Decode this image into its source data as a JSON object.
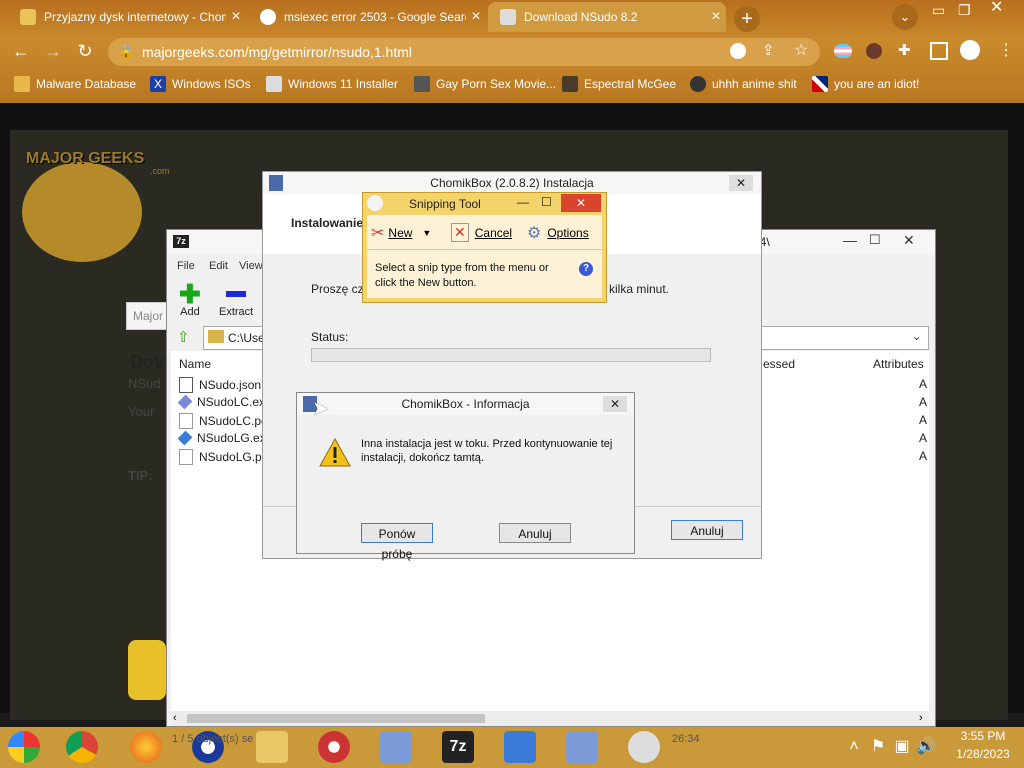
{
  "browser": {
    "tabs": [
      {
        "title": "Przyjazny dysk internetowy - Chomik",
        "active": false
      },
      {
        "title": "msiexec error 2503 - Google Search",
        "active": false
      },
      {
        "title": "Download NSudo 8.2",
        "active": true
      }
    ],
    "new_tab": "+",
    "url": "majorgeeks.com/mg/getmirror/nsudo,1.html",
    "bookmarks": [
      "Malware Database",
      "Windows ISOs",
      "Windows 11 Installer",
      "Gay Porn Sex Movie...",
      "Espectral McGee",
      "uhhh anime shit",
      "you are an idiot!"
    ]
  },
  "page": {
    "logo_text": "MAJOR GEEKS",
    "logo_sub": ".com",
    "fragments": {
      "heading": "Dov",
      "line1": "NSud",
      "line2": "Your",
      "tip": "TIP:",
      "field": "Major"
    }
  },
  "sevenzip": {
    "title_suffix": "er\\x64\\",
    "menu": [
      "File",
      "Edit",
      "View"
    ],
    "toolbar": [
      {
        "label": "Add"
      },
      {
        "label": "Extract"
      }
    ],
    "path": "C:\\Use",
    "columns": {
      "name": "Name",
      "packed": "essed",
      "attributes": "Attributes"
    },
    "files": [
      {
        "name": "NSudo.json",
        "attr": "A"
      },
      {
        "name": "NSudoLC.exe",
        "attr": "A"
      },
      {
        "name": "NSudoLC.pdb",
        "attr": "A"
      },
      {
        "name": "NSudoLG.exe",
        "attr": "A"
      },
      {
        "name": "NSudoLG.pdb",
        "attr": "A"
      }
    ],
    "status": "1 / 5 object(s) se",
    "status_time": "26:34"
  },
  "installer": {
    "title": "ChomikBox (2.0.8.2) Instalacja",
    "header": "Instalowanie",
    "desc_left": "Proszę cze",
    "desc_right": "kilka minut.",
    "status_label": "Status:",
    "progress": 0,
    "cancel": "Anuluj"
  },
  "info": {
    "title": "ChomikBox - Informacja",
    "message": "Inna instalacja jest w toku. Przed kontynuowanie tej instalacji, dokończ tamtą.",
    "retry": "Ponów próbę",
    "cancel": "Anuluj"
  },
  "snipping": {
    "title": "Snipping Tool",
    "new": "New",
    "cancel": "Cancel",
    "options": "Options",
    "hint": "Select a snip type from the menu or click the New button."
  },
  "taskbar": {
    "time": "3:55 PM",
    "date": "1/28/2023",
    "app_label": "7z"
  }
}
